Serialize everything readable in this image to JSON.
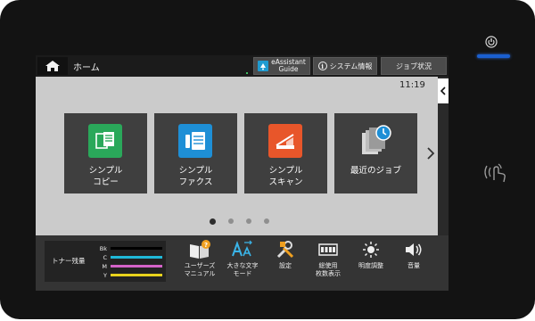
{
  "topbar": {
    "home_title": "ホーム",
    "eassistant_label": "eAssistant\nGuide",
    "system_info_label": "システム情報",
    "info_glyph": "i",
    "job_status_label": "ジョブ状況"
  },
  "main": {
    "clock": "11:19",
    "tiles": [
      {
        "label": "シンプル\nコピー",
        "icon": "copy-icon",
        "color": "#2aa85a"
      },
      {
        "label": "シンプル\nファクス",
        "icon": "fax-icon",
        "color": "#1e8fd6"
      },
      {
        "label": "シンプル\nスキャン",
        "icon": "scan-icon",
        "color": "#e8562a"
      },
      {
        "label": "最近のジョブ",
        "icon": "recent-jobs-icon",
        "color": "#5a5a5a"
      }
    ],
    "page_indicator": {
      "total": 4,
      "current": 1
    }
  },
  "bottombar": {
    "toner_title": "トナー残量",
    "toner": [
      {
        "color_label": "Bk",
        "bar_color": "#000000"
      },
      {
        "color_label": "C",
        "bar_color": "#1fb8d8"
      },
      {
        "color_label": "M",
        "bar_color": "#d462c8"
      },
      {
        "color_label": "Y",
        "bar_color": "#e8d21c"
      }
    ],
    "functions": [
      {
        "label": "ユーザーズ\nマニュアル",
        "icon": "manual-icon"
      },
      {
        "label": "大きな文字\nモード",
        "icon": "large-text-icon"
      },
      {
        "label": "設定",
        "icon": "settings-icon"
      },
      {
        "label": "総使用\n枚数表示",
        "icon": "counter-icon"
      },
      {
        "label": "明度調整",
        "icon": "brightness-icon"
      },
      {
        "label": "音量",
        "icon": "volume-icon"
      }
    ]
  },
  "accent_colors": {
    "power_led": "#1a5fd0",
    "indicator_green": "#3dbb5f"
  }
}
